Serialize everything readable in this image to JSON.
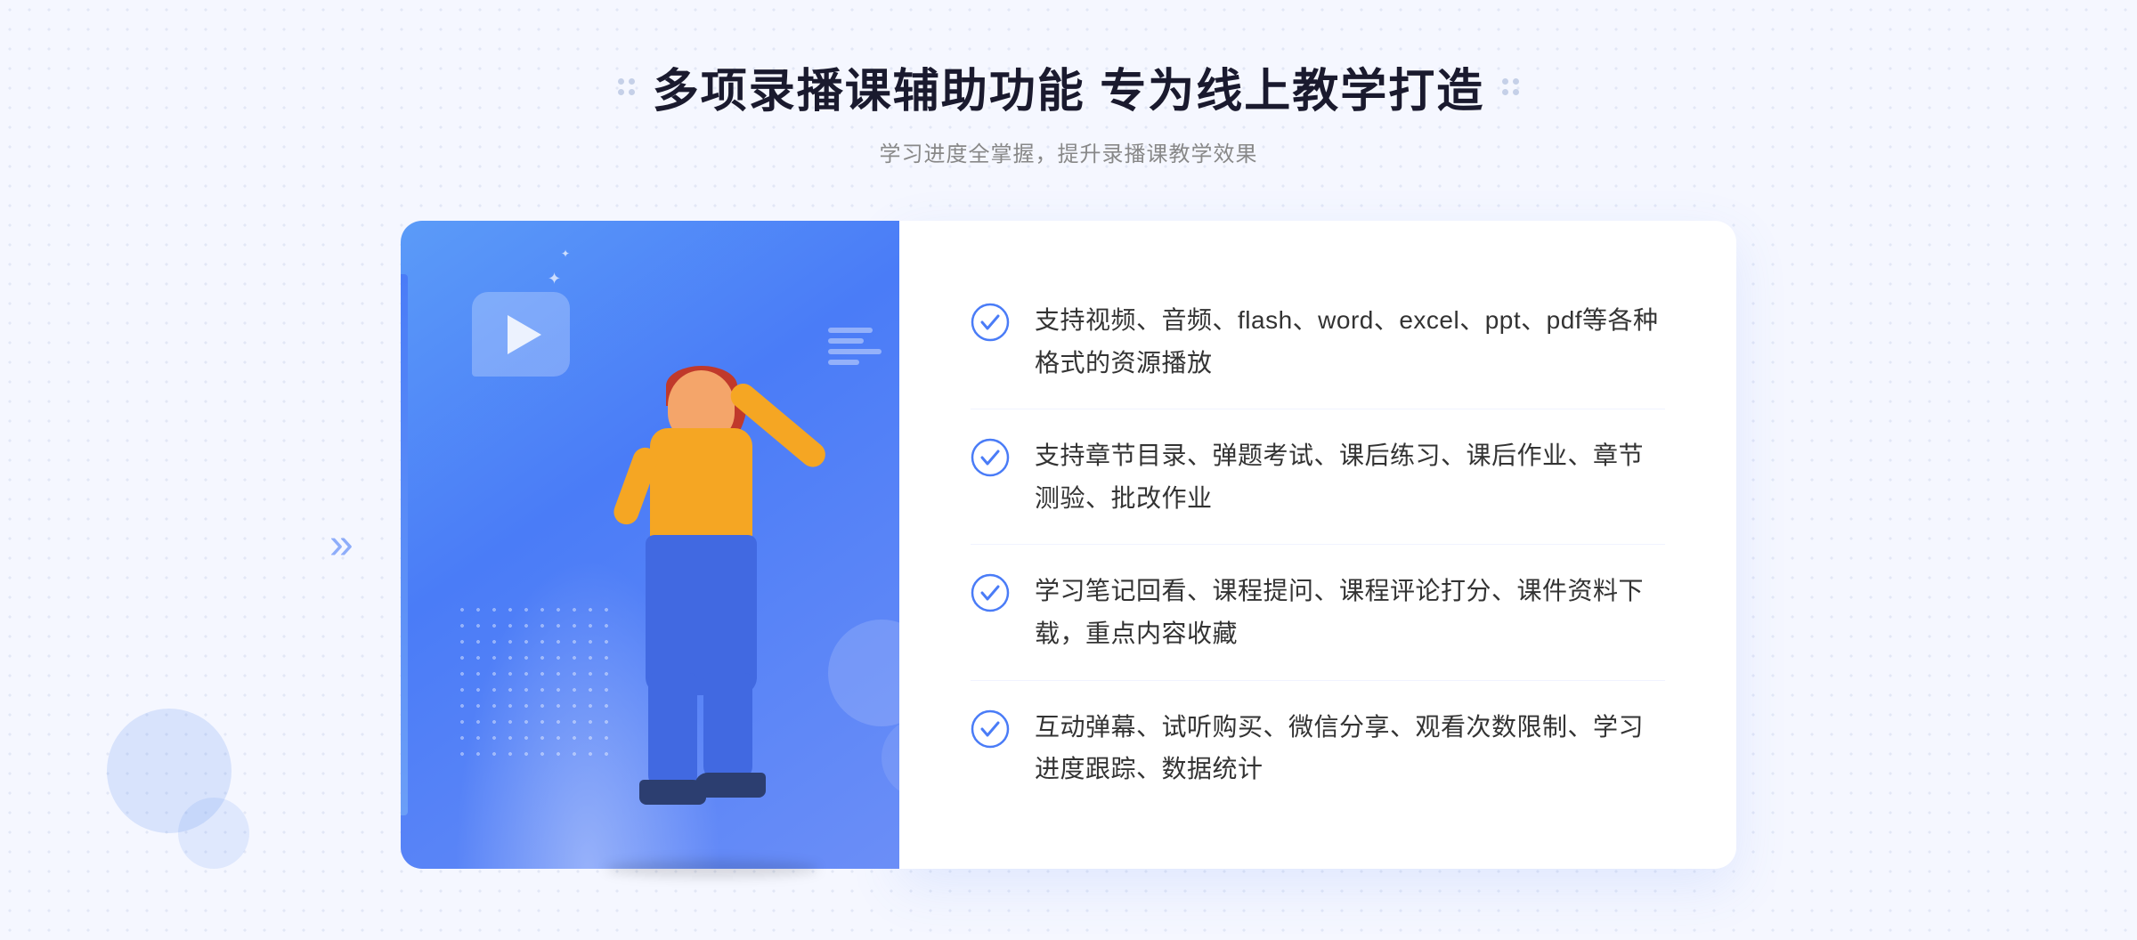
{
  "header": {
    "title": "多项录播课辅助功能 专为线上教学打造",
    "subtitle": "学习进度全掌握，提升录播课教学效果"
  },
  "features": [
    {
      "id": "feature-1",
      "text": "支持视频、音频、flash、word、excel、ppt、pdf等各种格式的资源播放"
    },
    {
      "id": "feature-2",
      "text": "支持章节目录、弹题考试、课后练习、课后作业、章节测验、批改作业"
    },
    {
      "id": "feature-3",
      "text": "学习笔记回看、课程提问、课程评论打分、课件资料下载，重点内容收藏"
    },
    {
      "id": "feature-4",
      "text": "互动弹幕、试听购买、微信分享、观看次数限制、学习进度跟踪、数据统计"
    }
  ],
  "colors": {
    "primary": "#4a7cf7",
    "check": "#4a7cf7",
    "title": "#1a1a2e",
    "text": "#333333",
    "subtitle": "#888888"
  },
  "decorations": {
    "left_chevron": "»"
  }
}
